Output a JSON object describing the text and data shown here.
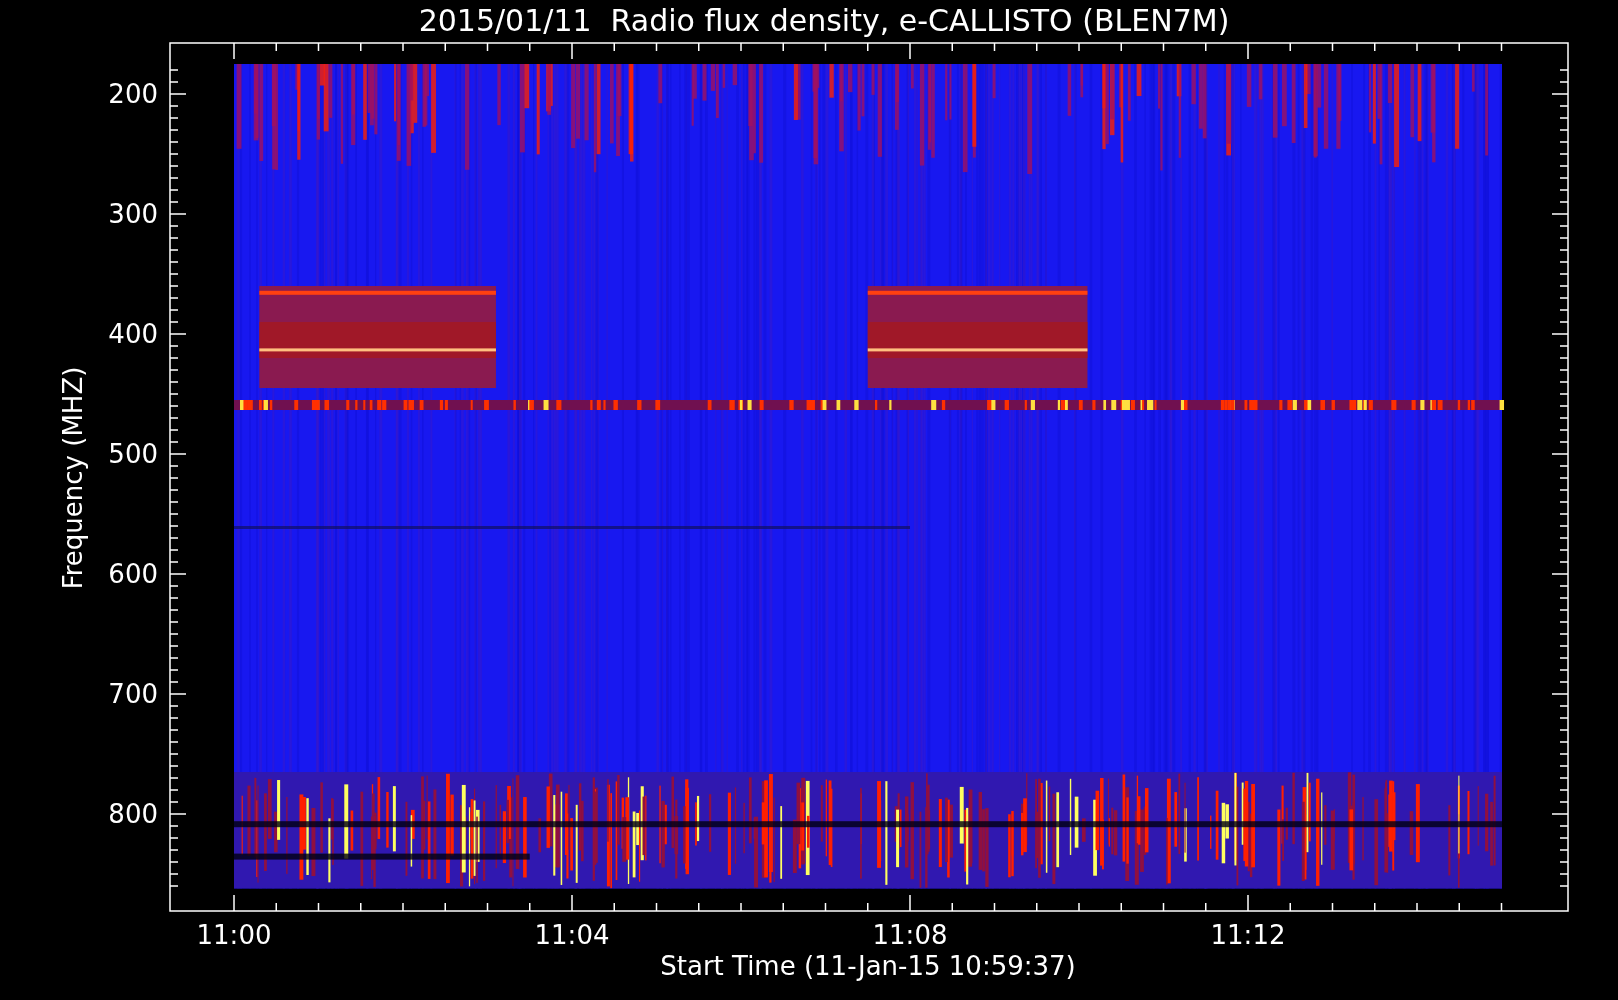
{
  "title": "2015/01/11  Radio flux density, e-CALLISTO (BLEN7M)",
  "plot": {
    "xlabel": "Start Time (11-Jan-15 10:59:37)",
    "ylabel": "Frequency (MHZ)",
    "xticks": [
      "11:00",
      "11:04",
      "11:08",
      "11:12"
    ],
    "yticks": [
      "200",
      "300",
      "400",
      "500",
      "600",
      "700",
      "800"
    ]
  }
}
